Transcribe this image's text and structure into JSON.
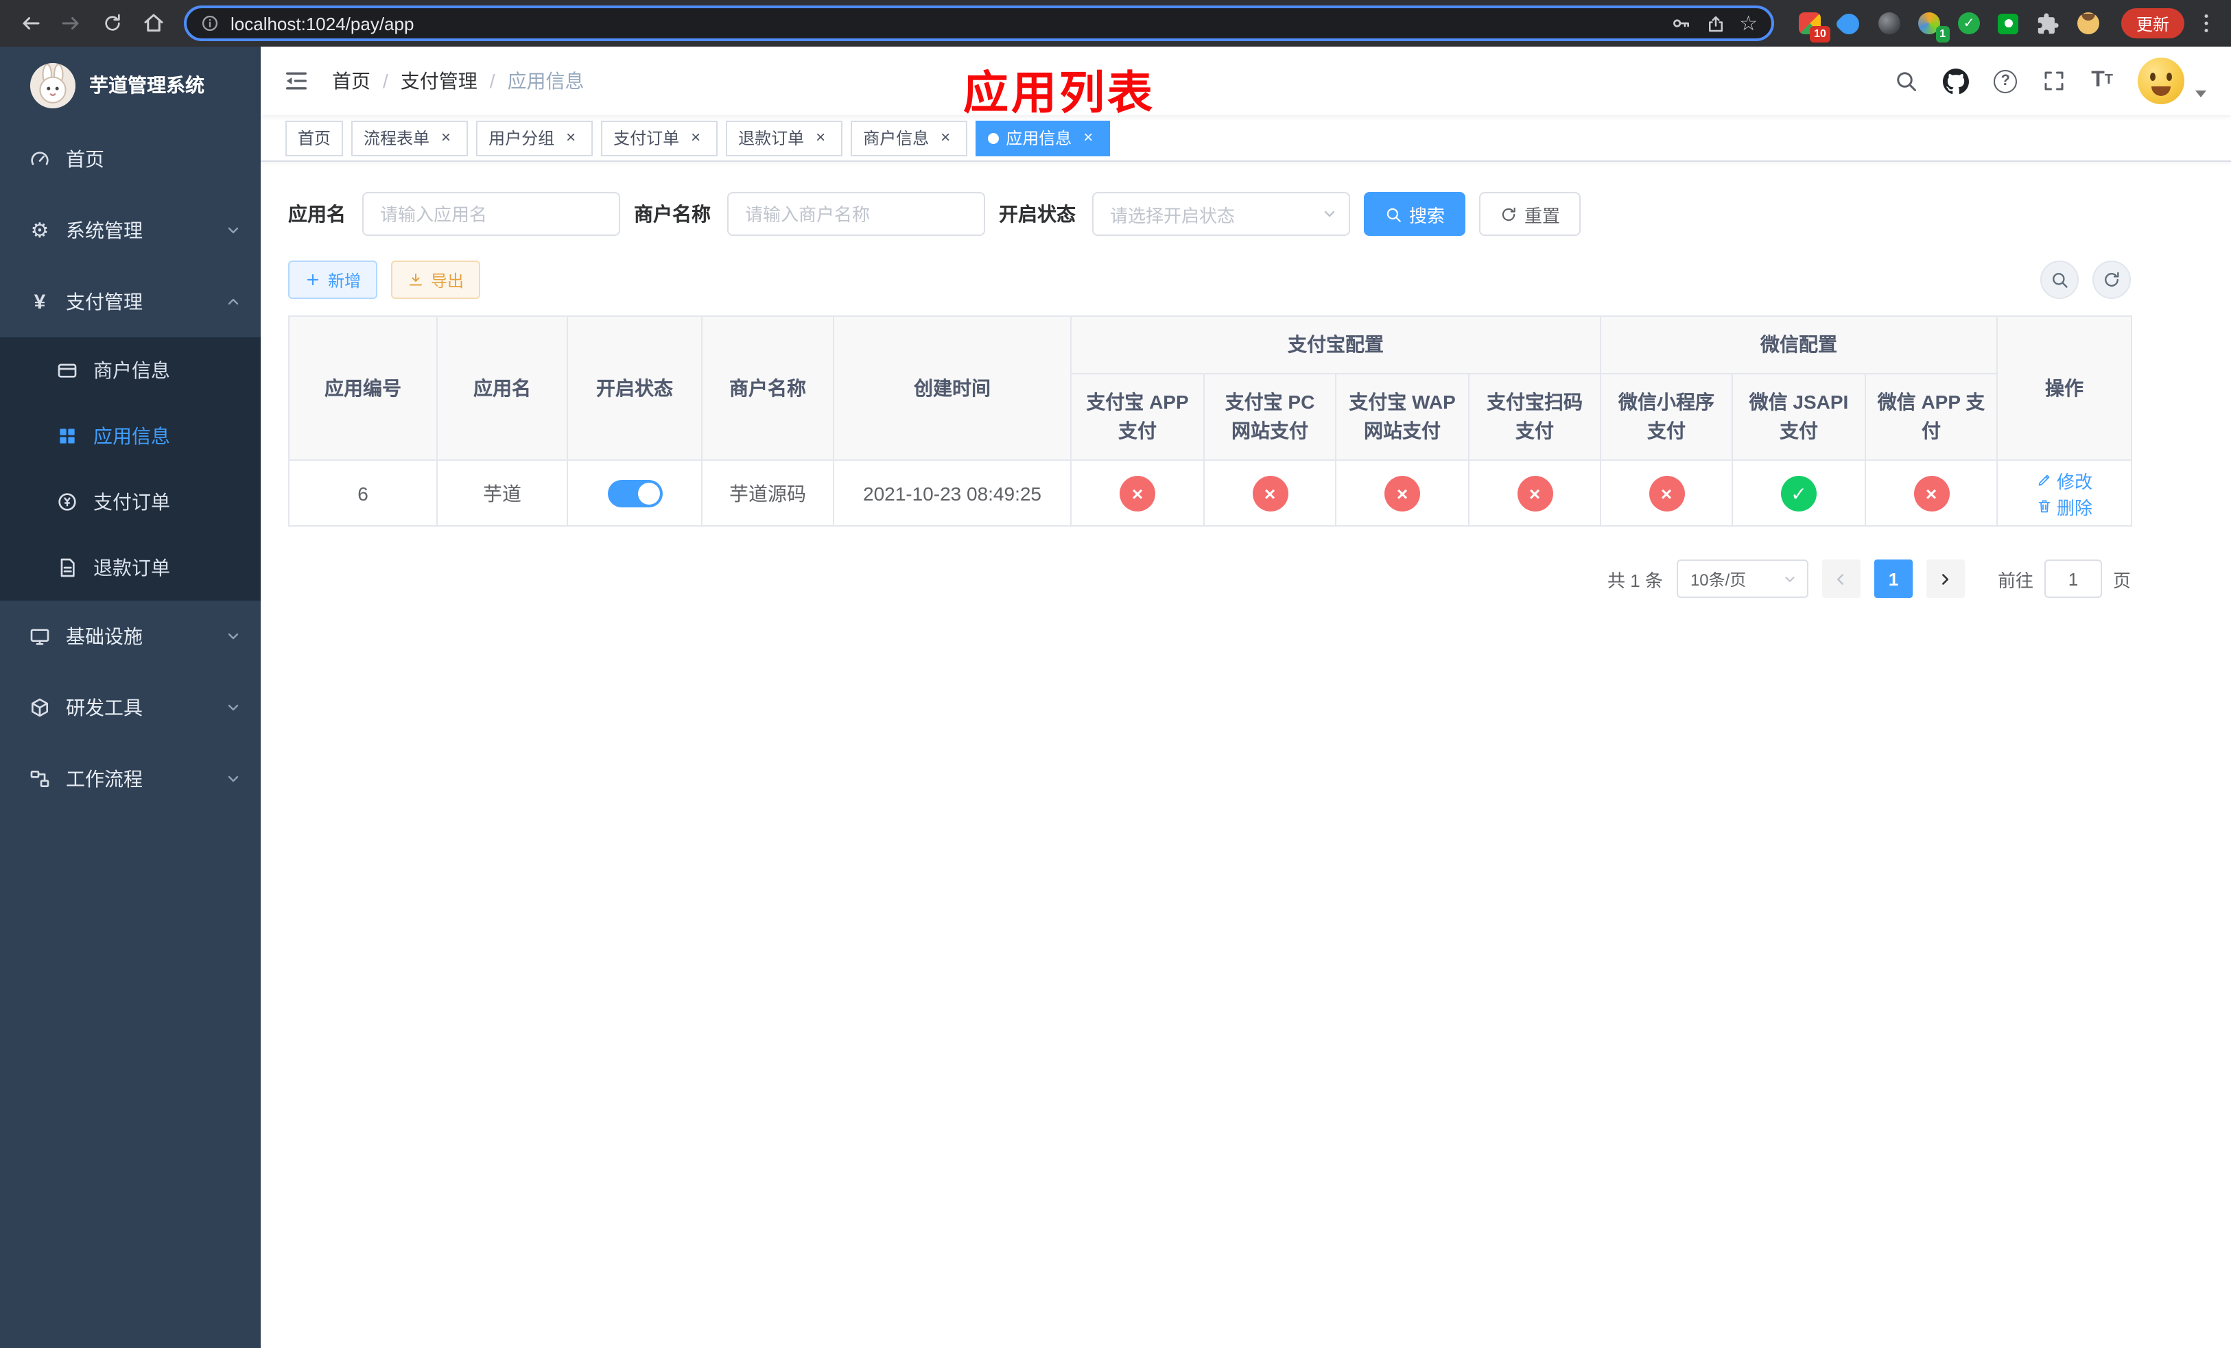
{
  "icons": {
    "close": "×",
    "check": "✓",
    "cross": "×",
    "gear": "⚙",
    "yen": "¥",
    "star": "☆",
    "question_mark": "?",
    "font_big": "T",
    "font_small": "T"
  },
  "colors": {
    "primary": "#409eff",
    "success": "#13ce66",
    "danger": "#f56c6c",
    "warning": "#e6a23c",
    "title_red": "#f70909",
    "sidebar_bg": "#304156",
    "submenu_bg": "#1f2d3d"
  },
  "browser": {
    "url": "localhost:1024/pay/app",
    "update_button": "更新",
    "ext_badge_grid": "10",
    "ext_badge_avatar": "1"
  },
  "sidebar": {
    "logo": "芋道管理系统",
    "home": "首页",
    "system": "系统管理",
    "payment": "支付管理",
    "merchant": "商户信息",
    "app_info": "应用信息",
    "pay_order": "支付订单",
    "refund_order": "退款订单",
    "infra": "基础设施",
    "dev_tools": "研发工具",
    "workflow": "工作流程"
  },
  "navbar": {
    "breadcrumb": {
      "home": "首页",
      "section": "支付管理",
      "current": "应用信息",
      "separator": "/"
    },
    "overlay_title": "应用列表"
  },
  "tabs": [
    {
      "label": "首页",
      "closable": false,
      "active": false
    },
    {
      "label": "流程表单",
      "closable": true,
      "active": false
    },
    {
      "label": "用户分组",
      "closable": true,
      "active": false
    },
    {
      "label": "支付订单",
      "closable": true,
      "active": false
    },
    {
      "label": "退款订单",
      "closable": true,
      "active": false
    },
    {
      "label": "商户信息",
      "closable": true,
      "active": false
    },
    {
      "label": "应用信息",
      "closable": true,
      "active": true
    }
  ],
  "filters": {
    "app_name_label": "应用名",
    "app_name_placeholder": "请输入应用名",
    "merchant_label": "商户名称",
    "merchant_placeholder": "请输入商户名称",
    "status_label": "开启状态",
    "status_placeholder": "请选择开启状态",
    "search_button": "搜索",
    "reset_button": "重置"
  },
  "toolbar": {
    "add_button": "新增",
    "export_button": "导出"
  },
  "table": {
    "group_alipay": "支付宝配置",
    "group_wechat": "微信配置",
    "col_id": "应用编号",
    "col_name": "应用名",
    "col_status": "开启状态",
    "col_merchant": "商户名称",
    "col_created": "创建时间",
    "col_alipay_app": "支付宝 APP 支付",
    "col_alipay_pc": "支付宝 PC 网站支付",
    "col_alipay_wap": "支付宝 WAP 网站支付",
    "col_alipay_qr": "支付宝扫码支付",
    "col_wx_mini": "微信小程序支付",
    "col_wx_jsapi": "微信 JSAPI 支付",
    "col_wx_app": "微信 APP 支付",
    "col_actions": "操作",
    "row": {
      "id": "6",
      "name": "芋道",
      "status_on": true,
      "merchant": "芋道源码",
      "created": "2021-10-23 08:49:25",
      "channel_status": [
        false,
        false,
        false,
        false,
        false,
        true,
        false
      ],
      "action_edit": "修改",
      "action_delete": "删除"
    }
  },
  "pagination": {
    "total": "共 1 条",
    "page_size": "10条/页",
    "current_page": "1",
    "jump_prefix": "前往",
    "jump_value": "1",
    "jump_suffix": "页"
  }
}
